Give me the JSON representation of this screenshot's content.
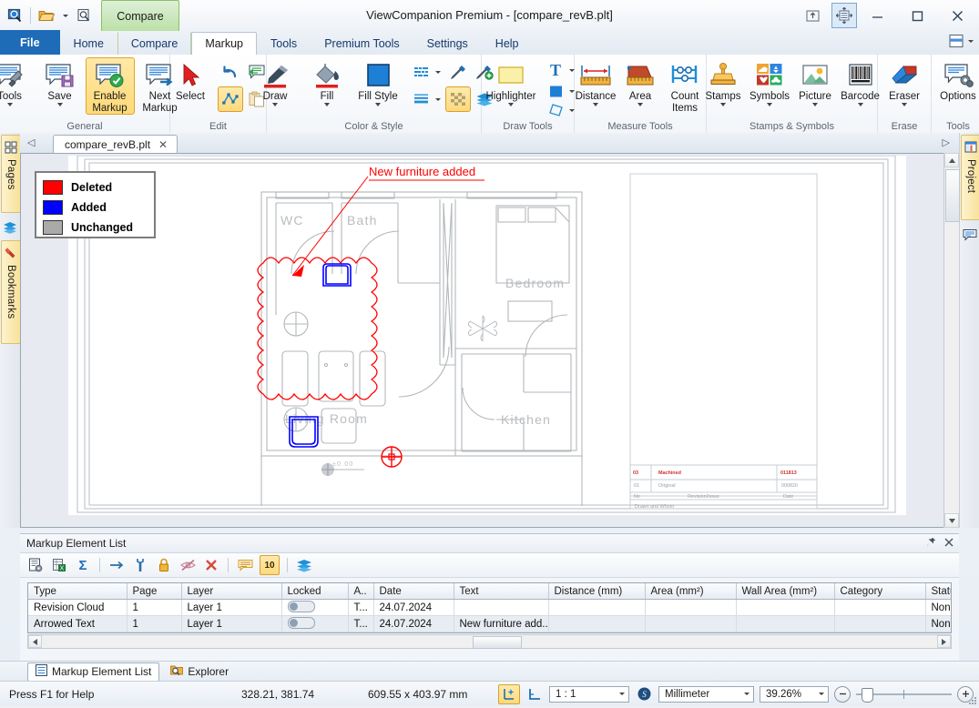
{
  "window": {
    "title": "ViewCompanion Premium - [compare_revB.plt]",
    "floating_tab": "Compare",
    "minimize": "–",
    "maximize": "□",
    "close": "✕"
  },
  "quick_access": {
    "items": [
      {
        "name": "app-icon",
        "icon": "magnifier-screen-icon"
      },
      {
        "name": "open-folder",
        "icon": "folder-icon"
      },
      {
        "name": "open-folder-dropdown",
        "icon": "chevron-down-icon"
      },
      {
        "name": "preview",
        "icon": "preview-magnifier-icon"
      },
      {
        "name": "qat-more",
        "icon": "more-icon"
      }
    ]
  },
  "ribbon": {
    "tabs": [
      {
        "label": "File",
        "active": false,
        "file": true
      },
      {
        "label": "Home",
        "active": false
      },
      {
        "label": "Compare",
        "active": false
      },
      {
        "label": "Markup",
        "active": true
      },
      {
        "label": "Tools",
        "active": false
      },
      {
        "label": "Premium Tools",
        "active": false
      },
      {
        "label": "Settings",
        "active": false
      },
      {
        "label": "Help",
        "active": false
      }
    ],
    "groups": [
      {
        "title": "General",
        "buttons": [
          {
            "label": "Tools",
            "icon": "markup-tools-icon",
            "dropdown": true,
            "selected": false
          },
          {
            "label": "Save",
            "icon": "markup-save-icon",
            "dropdown": true,
            "selected": false
          },
          {
            "label": "Enable Markup",
            "icon": "markup-enable-icon",
            "dropdown": false,
            "selected": true
          },
          {
            "label": "Next Markup",
            "icon": "markup-next-icon",
            "dropdown": false,
            "selected": false
          }
        ]
      },
      {
        "title": "Edit",
        "buttons": [
          {
            "label": "Select",
            "icon": "arrow-cursor-icon",
            "dropdown": false,
            "selected": false
          }
        ],
        "minis": [
          {
            "name": "undo-icon",
            "selected": false
          },
          {
            "name": "edit-text-icon",
            "selected": false
          },
          {
            "name": "edit-nodes-icon",
            "selected": true
          },
          {
            "name": "paste-icon",
            "selected": false
          }
        ]
      },
      {
        "title": "Color & Style",
        "buttons": [
          {
            "label": "Draw",
            "icon": "draw-brush-icon",
            "dropdown": true,
            "selected": false
          },
          {
            "label": "Fill",
            "icon": "fill-bucket-icon",
            "dropdown": true,
            "selected": false
          },
          {
            "label": "Fill Style",
            "icon": "fill-style-swatch-icon",
            "dropdown": true,
            "selected": false
          }
        ],
        "minis": [
          {
            "name": "line-style-icon",
            "selected": false
          },
          {
            "name": "line-style-dropdown-icon",
            "selected": false
          },
          {
            "name": "eyedropper-icon",
            "selected": false
          },
          {
            "name": "eyedropper-add-icon",
            "selected": false
          },
          {
            "name": "line-width-icon",
            "selected": false
          },
          {
            "name": "line-width-dropdown-icon",
            "selected": false
          },
          {
            "name": "transparency-checker-icon",
            "selected": true
          },
          {
            "name": "layers-icon",
            "selected": false
          }
        ]
      },
      {
        "title": "Draw Tools",
        "buttons": [
          {
            "label": "Highlighter",
            "icon": "highlighter-rect-icon",
            "dropdown": true,
            "selected": false
          }
        ],
        "minis": [
          {
            "name": "text-tool-icon",
            "selected": false
          },
          {
            "name": "text-dropdown-icon",
            "selected": false
          },
          {
            "name": "rectangle-fill-icon",
            "selected": false
          },
          {
            "name": "rectangle-dropdown-icon",
            "selected": false
          },
          {
            "name": "polygon-shape-icon",
            "selected": false
          },
          {
            "name": "polygon-dropdown-icon",
            "selected": false
          }
        ]
      },
      {
        "title": "Measure Tools",
        "buttons": [
          {
            "label": "Distance",
            "icon": "measure-distance-icon",
            "dropdown": true,
            "selected": false
          },
          {
            "label": "Area",
            "icon": "measure-area-icon",
            "dropdown": true,
            "selected": false
          },
          {
            "label": "Count Items",
            "icon": "count-items-icon",
            "dropdown": false,
            "selected": false
          }
        ]
      },
      {
        "title": "Stamps & Symbols",
        "buttons": [
          {
            "label": "Stamps",
            "icon": "stamp-icon",
            "dropdown": true,
            "selected": false
          },
          {
            "label": "Symbols",
            "icon": "symbols-grid-icon",
            "dropdown": true,
            "selected": false
          },
          {
            "label": "Picture",
            "icon": "picture-icon",
            "dropdown": true,
            "selected": false
          },
          {
            "label": "Barcode",
            "icon": "barcode-icon",
            "dropdown": true,
            "selected": false
          }
        ]
      },
      {
        "title": "Erase",
        "buttons": [
          {
            "label": "Eraser",
            "icon": "eraser-icon",
            "dropdown": true,
            "selected": false
          }
        ]
      },
      {
        "title": "Tools",
        "buttons": [
          {
            "label": "Options",
            "icon": "markup-options-icon",
            "dropdown": false,
            "selected": false
          }
        ]
      }
    ]
  },
  "left_rail": {
    "tabs": [
      {
        "label": "Pages",
        "icon": "pages-grid-icon"
      },
      {
        "label": "Bookmarks",
        "icon": "bookmark-ribbon-icon"
      }
    ],
    "standalone_icon": "layers-stack-icon"
  },
  "right_rail": {
    "tabs": [
      {
        "label": "Project",
        "icon": "project-panel-icon"
      }
    ],
    "standalone_icon": "comment-balloon-icon"
  },
  "document": {
    "tab_label": "compare_revB.plt",
    "tab_close": "✕",
    "nav_left": "◁",
    "nav_right": "▷"
  },
  "legend": {
    "rows": [
      {
        "label": "Deleted",
        "color": "#ff0000"
      },
      {
        "label": "Added",
        "color": "#0000ff"
      },
      {
        "label": "Unchanged",
        "color": "#aaaaaa"
      }
    ]
  },
  "drawing": {
    "annotation_text": "New furniture added",
    "annotation_color": "#ff0000",
    "room_labels": [
      "WC",
      "Bath",
      "Bedroom",
      "Living Room",
      "Kitchen"
    ],
    "dim_label": "±0.00"
  },
  "markup_panel": {
    "title": "Markup Element List",
    "pin": "📌",
    "close": "✕",
    "toolbar": [
      {
        "name": "properties-icon",
        "label": ""
      },
      {
        "name": "export-excel-icon",
        "label": ""
      },
      {
        "name": "sum-sigma-icon",
        "label": "Σ"
      },
      {
        "name": "goto-arrow-icon",
        "label": "→"
      },
      {
        "name": "settings-wrench-icon",
        "label": ""
      },
      {
        "name": "lock-icon",
        "label": ""
      },
      {
        "name": "hide-icon",
        "label": ""
      },
      {
        "name": "delete-icon",
        "label": "✕"
      },
      {
        "name": "comment-icon",
        "label": ""
      },
      {
        "name": "count-badge-icon",
        "label": "10"
      },
      {
        "name": "layers-icon",
        "label": ""
      }
    ],
    "columns": [
      "Type",
      "Page",
      "Layer",
      "Locked",
      "A..",
      "Date",
      "Text",
      "Distance (mm)",
      "Area (mm²)",
      "Wall Area (mm²)",
      "Category",
      "Status"
    ],
    "rows": [
      {
        "Type": "Revision Cloud",
        "Page": "1",
        "Layer": "Layer 1",
        "Locked": "toggle-off",
        "A..": "T...",
        "Date": "24.07.2024",
        "Text": "",
        "Distance (mm)": "",
        "Area (mm²)": "",
        "Wall Area (mm²)": "",
        "Category": "",
        "Status": "None"
      },
      {
        "Type": "Arrowed Text",
        "Page": "1",
        "Layer": "Layer 1",
        "Locked": "toggle-off",
        "A..": "T...",
        "Date": "24.07.2024",
        "Text": "New furniture add...",
        "Distance (mm)": "",
        "Area (mm²)": "",
        "Wall Area (mm²)": "",
        "Category": "",
        "Status": "None"
      }
    ]
  },
  "bottom_tabs": [
    {
      "label": "Markup Element List",
      "icon": "list-icon",
      "active": true
    },
    {
      "label": "Explorer",
      "icon": "explorer-folder-icon",
      "active": false
    }
  ],
  "status_bar": {
    "help": "Press F1 for Help",
    "coordinates": "328.21, 381.74",
    "page_size": "609.55 x 403.97 mm",
    "scale_icon": "scale-set-icon",
    "measure_icon": "measure-corner-icon",
    "scale_value": "1 : 1",
    "units_icon": "units-globe-icon",
    "units_value": "Millimeter",
    "zoom_value": "39.26%",
    "zoom_out": "−",
    "zoom_in": "+"
  }
}
